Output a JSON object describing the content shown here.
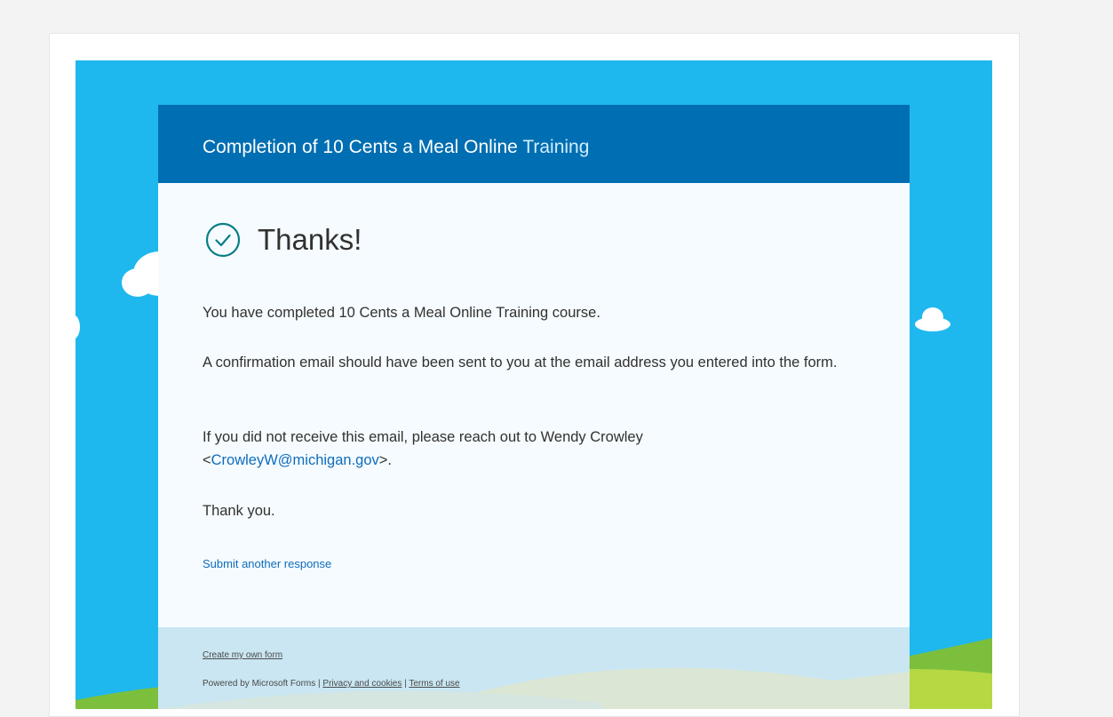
{
  "form": {
    "title_main": "Completion of 10 Cents a Meal Online ",
    "title_highlight": "Training",
    "thanks_heading": "Thanks!",
    "message_completed": "You have completed 10 Cents a Meal Online Training course.",
    "message_confirmation": "A confirmation email should have been sent to you at the email address you entered into the form.",
    "message_contact_prefix": "If you did not receive this email, please reach out to Wendy Crowley",
    "contact_email_open": "<",
    "contact_email": "CrowleyW@michigan.gov",
    "contact_email_close": ">.",
    "message_thank_you": "Thank you.",
    "submit_another_label": "Submit another response"
  },
  "footer": {
    "create_form_label": "Create my own form",
    "powered_by": "Powered by Microsoft Forms | ",
    "privacy_label": "Privacy and cookies",
    "separator": " | ",
    "terms_label": "Terms of use"
  },
  "colors": {
    "page_bg": "#f3f3f3",
    "sky_blue": "#1fb8ee",
    "header_blue": "#006eb2",
    "link_blue": "#0f6cbd",
    "check_teal": "#0a7d86",
    "hill_green": "#7cbf3c"
  },
  "icons": {
    "check": "check-circle-icon",
    "cloud": "cloud-icon"
  }
}
